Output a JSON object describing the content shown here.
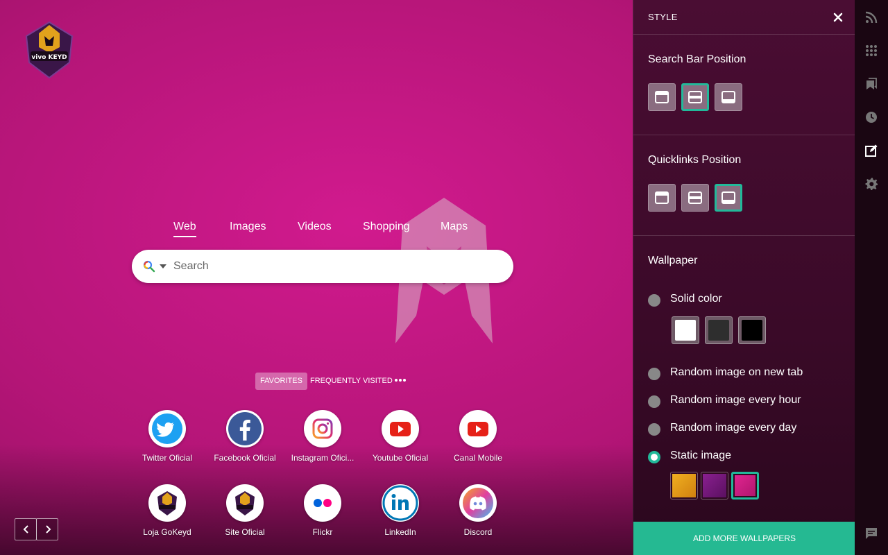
{
  "search": {
    "tabs": [
      {
        "label": "Web",
        "active": true
      },
      {
        "label": "Images"
      },
      {
        "label": "Videos"
      },
      {
        "label": "Shopping"
      },
      {
        "label": "Maps"
      }
    ],
    "placeholder": "Search"
  },
  "quicklinks": {
    "tabs": [
      {
        "label": "FAVORITES",
        "active": true
      },
      {
        "label": "FREQUENTLY VISITED"
      }
    ],
    "items": [
      {
        "label": "Twitter Oficial",
        "icon": "twitter-icon"
      },
      {
        "label": "Facebook Oficial",
        "icon": "facebook-icon"
      },
      {
        "label": "Instagram Ofici...",
        "icon": "instagram-icon"
      },
      {
        "label": "Youtube Oficial",
        "icon": "youtube-icon"
      },
      {
        "label": "Canal Mobile",
        "icon": "youtube-icon"
      },
      {
        "label": "Loja GoKeyd",
        "icon": "vivokeyd-logo-icon"
      },
      {
        "label": "Site Oficial",
        "icon": "vivokeyd-logo-icon"
      },
      {
        "label": "Flickr",
        "icon": "flickr-icon"
      },
      {
        "label": "LinkedIn",
        "icon": "linkedin-icon"
      },
      {
        "label": "Discord",
        "icon": "discord-icon"
      }
    ]
  },
  "panel": {
    "title": "STYLE",
    "search_bar_position": {
      "title": "Search Bar Position",
      "selected": "middle"
    },
    "quicklinks_position": {
      "title": "Quicklinks Position",
      "selected": "bottom"
    },
    "wallpaper": {
      "title": "Wallpaper",
      "options": [
        {
          "label": "Solid color",
          "checked": false
        },
        {
          "label": "Random image on new tab",
          "checked": false
        },
        {
          "label": "Random image every hour",
          "checked": false
        },
        {
          "label": "Random image every day",
          "checked": false
        },
        {
          "label": "Static image",
          "checked": true
        }
      ],
      "solid_colors": [
        "#ffffff",
        "#2e2e2e",
        "#000000"
      ],
      "static_thumbs": [
        {
          "color": "#e8a012",
          "selected": false
        },
        {
          "color": "#7a1a7a",
          "selected": false
        },
        {
          "color": "#d0207f",
          "selected": true
        }
      ]
    },
    "add_button": "ADD MORE WALLPAPERS"
  },
  "colors": {
    "accent": "#25b992",
    "background": "#b41577"
  },
  "logo_text": "vivo KEYD"
}
